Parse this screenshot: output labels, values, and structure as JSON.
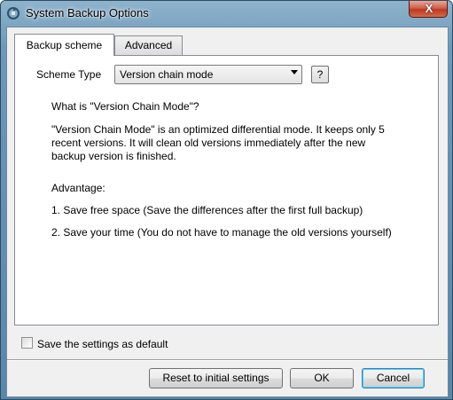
{
  "window": {
    "title": "System Backup Options",
    "close_label": "X"
  },
  "tabs": [
    {
      "label": "Backup scheme",
      "active": true
    },
    {
      "label": "Advanced",
      "active": false
    }
  ],
  "scheme": {
    "type_label": "Scheme Type",
    "selected": "Version chain mode",
    "help_label": "?"
  },
  "description": {
    "heading": "What is \"Version Chain Mode\"?",
    "body_lines": [
      "\"Version Chain Mode\" is an optimized differential mode. It keeps only 5",
      "recent versions. It will clean old versions immediately after the new",
      "backup version is finished."
    ],
    "advantage_label": "Advantage:",
    "points": [
      "1. Save free space (Save the differences after the first full backup)",
      "2. Save your time (You do not have to manage the old versions yourself)"
    ]
  },
  "default_checkbox": {
    "label": "Save the settings as default",
    "checked": false
  },
  "buttons": {
    "reset": "Reset to initial settings",
    "ok": "OK",
    "cancel": "Cancel"
  },
  "icons": {
    "app": "backup-app-icon",
    "close": "close-icon",
    "dropdown": "chevron-down-icon"
  }
}
